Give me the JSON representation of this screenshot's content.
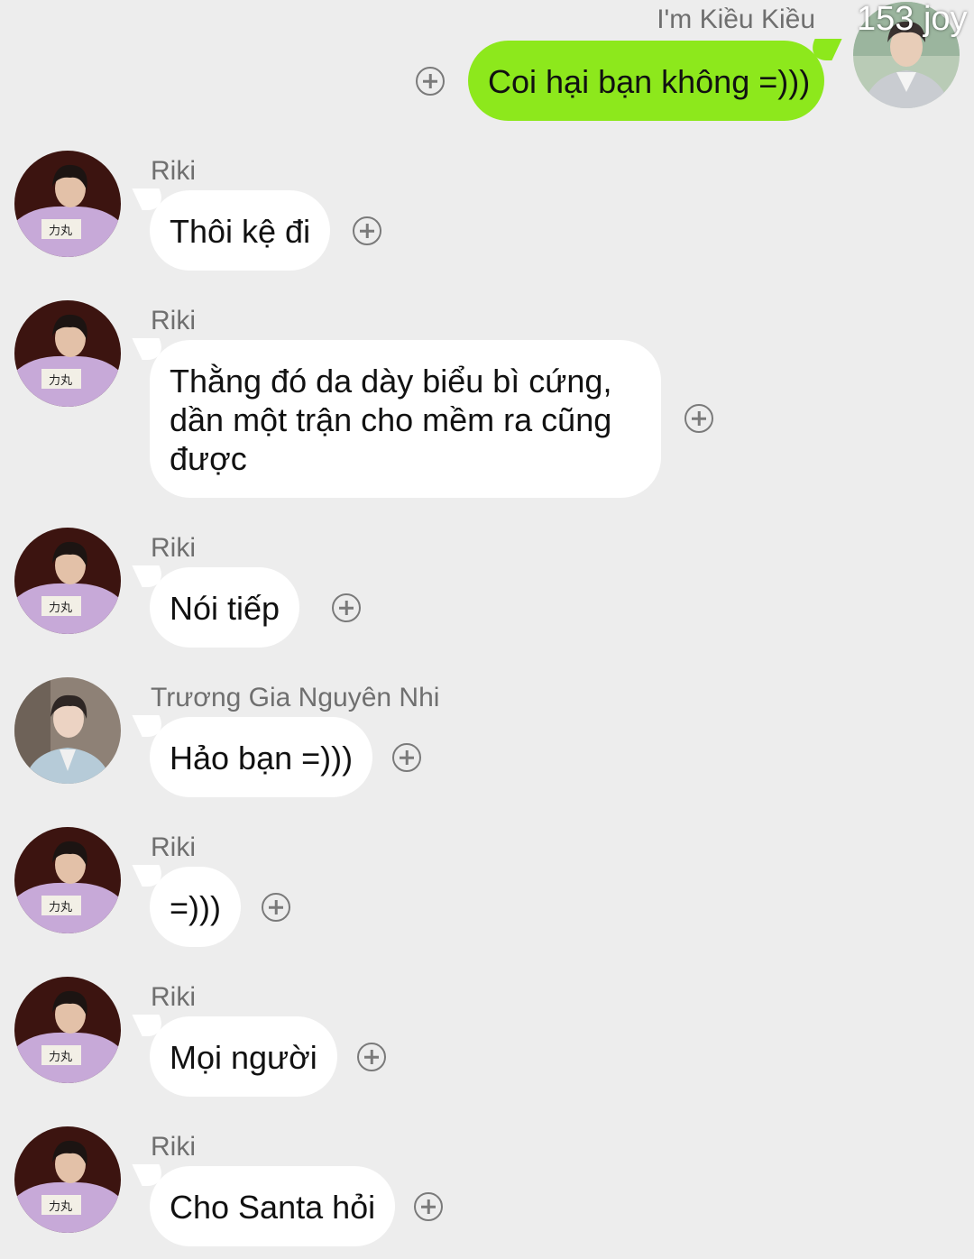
{
  "watermark": "153 joy",
  "own_message": {
    "sender": "I'm Kiều Kiều",
    "text": "Coi hại bạn không =)))"
  },
  "messages": [
    {
      "sender": "Riki",
      "text": "Thôi kệ đi"
    },
    {
      "sender": "Riki",
      "lines": [
        "Thằng đó da dày biểu bì cứng,",
        "dần một trận cho mềm ra cũng",
        "được"
      ]
    },
    {
      "sender": "Riki",
      "text": "Nói tiếp"
    },
    {
      "sender": "Trương Gia Nguyên Nhi",
      "text": "Hảo bạn =)))"
    },
    {
      "sender": "Riki",
      "text": "=)))"
    },
    {
      "sender": "Riki",
      "text": "Mọi người"
    },
    {
      "sender": "Riki",
      "text": "Cho Santa hỏi"
    }
  ],
  "icons": {
    "add_reaction": "plus-circle-icon"
  },
  "colors": {
    "own_bubble": "#8de81c",
    "other_bubble": "#ffffff",
    "background": "#ededed"
  }
}
